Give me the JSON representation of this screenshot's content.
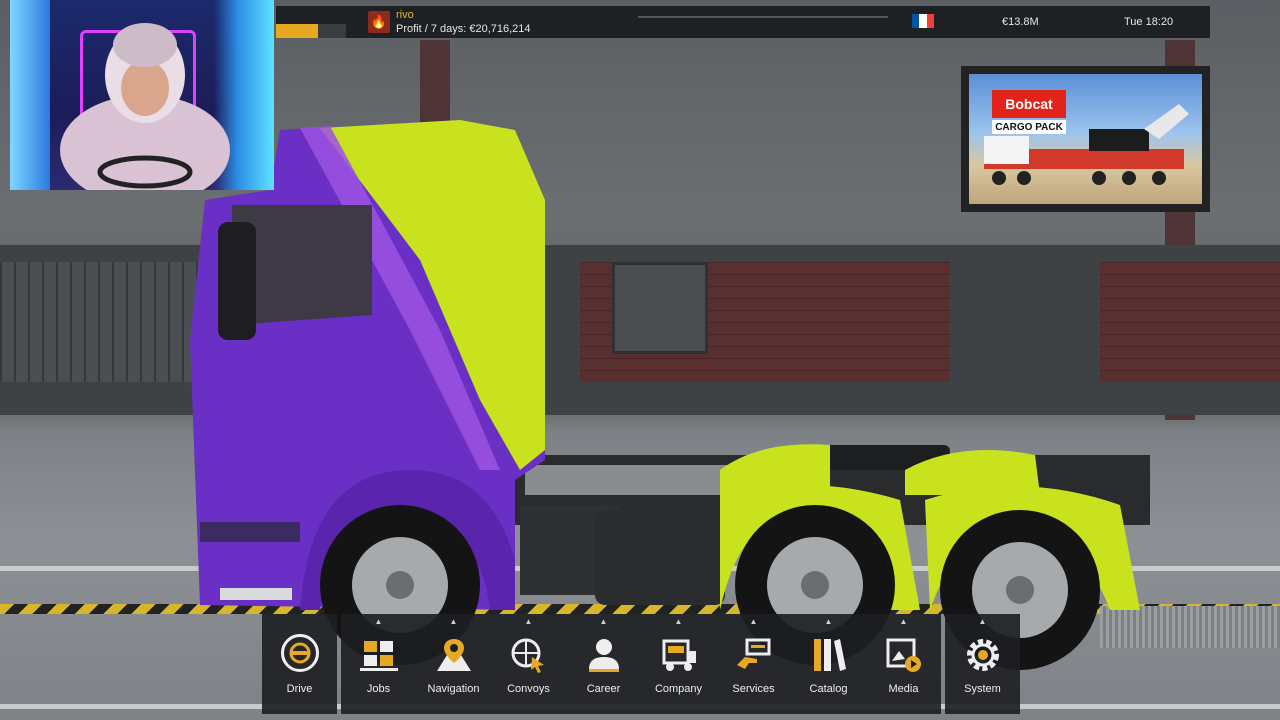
{
  "hud": {
    "username": "rivo",
    "profit": "Profit / 7 days: €20,716,214",
    "money": "€13.8M",
    "clock": "Tue 18:20",
    "xp_progress": 0.6,
    "flag_colors": [
      "#0055a4",
      "#ffffff",
      "#ef4135"
    ]
  },
  "ad": {
    "brand": "Bobcat",
    "title": "CARGO PACK"
  },
  "menu": {
    "drive": "Drive",
    "items": [
      "Jobs",
      "Navigation",
      "Convoys",
      "Career",
      "Company",
      "Services",
      "Catalog",
      "Media"
    ],
    "system": "System"
  },
  "colors": {
    "accent": "#e7a823",
    "truck_purple": "#6a2fc4",
    "truck_lime": "#c8e21e"
  }
}
